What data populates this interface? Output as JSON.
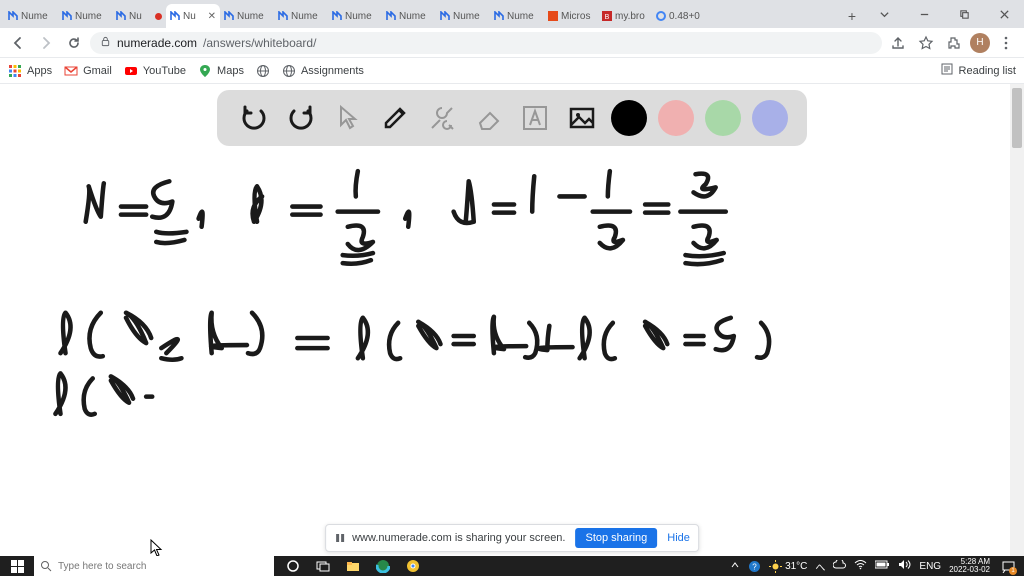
{
  "window": {
    "title": "Numerade"
  },
  "tabs": {
    "items": [
      {
        "label": "Nume",
        "active": false,
        "rec": false
      },
      {
        "label": "Nume",
        "active": false,
        "rec": false
      },
      {
        "label": "Nu",
        "active": false,
        "rec": true
      },
      {
        "label": "Nu",
        "active": true,
        "rec": false,
        "close": "✕"
      },
      {
        "label": "Nume",
        "active": false,
        "rec": false
      },
      {
        "label": "Nume",
        "active": false,
        "rec": false
      },
      {
        "label": "Nume",
        "active": false,
        "rec": false
      },
      {
        "label": "Nume",
        "active": false,
        "rec": false
      },
      {
        "label": "Nume",
        "active": false,
        "rec": false
      },
      {
        "label": "Nume",
        "active": false,
        "rec": false
      },
      {
        "label": "Micros",
        "active": false,
        "rec": false,
        "brand": "office"
      },
      {
        "label": "my.bro",
        "active": false,
        "rec": false,
        "brand": "brock"
      },
      {
        "label": "0.48+0",
        "active": false,
        "rec": false,
        "brand": "google"
      }
    ],
    "new": "+"
  },
  "address": {
    "domain": "numerade.com",
    "path": "/answers/whiteboard/",
    "avatar_letter": "H"
  },
  "bookmarks": {
    "apps": "Apps",
    "gmail": "Gmail",
    "youtube": "YouTube",
    "maps": "Maps",
    "reading": "Reading list"
  },
  "toolbar": {
    "colors": {
      "black": "#000000",
      "red": "#f0b0b0",
      "green": "#a8d8a8",
      "blue": "#a8b0e8"
    }
  },
  "share": {
    "msg": "www.numerade.com is sharing your screen.",
    "stop": "Stop sharing",
    "hide": "Hide"
  },
  "taskbar": {
    "search_placeholder": "Type here to search",
    "temp": "31°C",
    "lang1": "へ",
    "lang2": "ENG",
    "time": "5:28 AM",
    "date": "2022-03-02",
    "notif_count": "1"
  },
  "whiteboard_math": {
    "line1": "n = 5 ,  p = 1/3 ,  q = 1 − 1/3 = 2/3",
    "line2": "P(x ≥ 4)  =  P(x = 4) + P(x = 5)",
    "line3": "P(x ·"
  }
}
